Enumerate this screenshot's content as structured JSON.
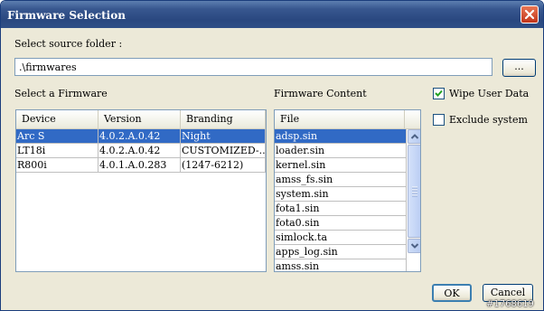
{
  "window": {
    "title": "Firmware Selection"
  },
  "source": {
    "label": "Select source folder :",
    "path": ".\\firmwares",
    "browse_label": "..."
  },
  "firmware_list": {
    "label": "Select a Firmware",
    "columns": [
      "Device",
      "Version",
      "Branding"
    ],
    "rows": [
      {
        "device": "Arc S",
        "version": "4.0.2.A.0.42",
        "branding": "Night",
        "selected": true
      },
      {
        "device": "LT18i",
        "version": "4.0.2.A.0.42",
        "branding": "CUSTOMIZED-...",
        "selected": false
      },
      {
        "device": "R800i",
        "version": "4.0.1.A.0.283",
        "branding": "(1247-6212)",
        "selected": false
      }
    ]
  },
  "content": {
    "label": "Firmware Content",
    "column": "File",
    "files": [
      "adsp.sin",
      "loader.sin",
      "kernel.sin",
      "amss_fs.sin",
      "system.sin",
      "fota1.sin",
      "fota0.sin",
      "simlock.ta",
      "apps_log.sin",
      "amss.sin"
    ],
    "selected_index": 0
  },
  "options": {
    "wipe_user_data": {
      "label": "Wipe User Data",
      "checked": true
    },
    "exclude_system": {
      "label": "Exclude system",
      "checked": false
    }
  },
  "buttons": {
    "ok": "OK",
    "cancel": "Cancel"
  },
  "watermark": "#1768619",
  "colors": {
    "titlebar": "#2a4880",
    "selection": "#316ac5",
    "close": "#c2351a"
  }
}
